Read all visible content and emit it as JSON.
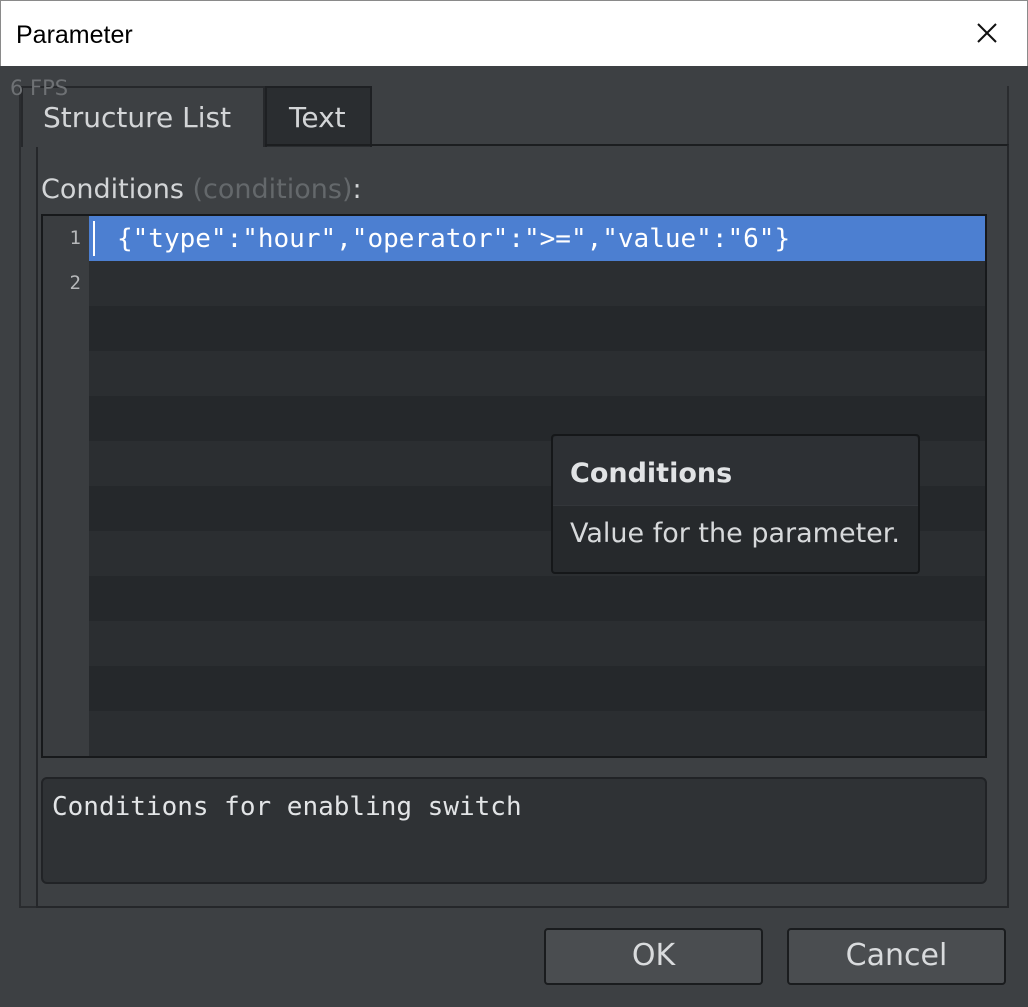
{
  "window": {
    "title": "Parameter",
    "fps_overlay": "6 FPS"
  },
  "tabs": [
    {
      "label": "Structure List",
      "active": true
    },
    {
      "label": "Text",
      "active": false
    }
  ],
  "field": {
    "label": "Conditions",
    "key_open": " (",
    "key": "conditions",
    "key_close": ")",
    "colon": ":"
  },
  "editor": {
    "lines": [
      {
        "number": "1",
        "text": "{\"type\":\"hour\",\"operator\":\">=\",\"value\":\"6\"}"
      },
      {
        "number": "2",
        "text": ""
      }
    ],
    "selection_color": "#4c7fd1"
  },
  "tooltip": {
    "title": "Conditions",
    "body": "Value for the parameter."
  },
  "description": "Conditions for enabling switch",
  "buttons": {
    "ok": "OK",
    "cancel": "Cancel"
  }
}
